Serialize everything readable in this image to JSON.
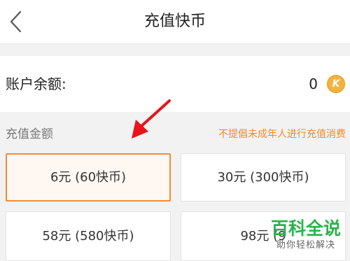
{
  "header": {
    "title": "充值快币",
    "back_icon": "chevron-left-icon"
  },
  "balance": {
    "label": "账户余额:",
    "value": "0",
    "coin_icon_letter": "K",
    "coin_color": "#f4b23d"
  },
  "recharge": {
    "section_label": "充值金额",
    "notice": "不提倡未成年人进行充值消费",
    "notice_color": "#f08a2a",
    "selected_index": 0,
    "options": [
      {
        "label": "6元 (60快币)"
      },
      {
        "label": "30元 (300快币)"
      },
      {
        "label": "58元 (580快币)"
      },
      {
        "label": "98元 (9"
      }
    ]
  },
  "annotation": {
    "arrow_color": "#e8141a"
  },
  "watermark": {
    "main": "百科全说",
    "sub": "助你轻松解决",
    "color": "#2bb24c"
  }
}
